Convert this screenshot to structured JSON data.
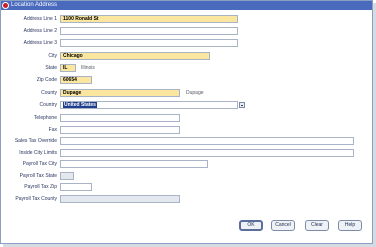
{
  "window": {
    "title": "Location Address"
  },
  "fields": {
    "address1": {
      "label": "Address Line 1",
      "value": "1100 Ronald St"
    },
    "address2": {
      "label": "Address Line 2",
      "value": ""
    },
    "address3": {
      "label": "Address Line 3",
      "value": ""
    },
    "city": {
      "label": "City",
      "value": "Chicago"
    },
    "state": {
      "label": "State",
      "value": "IL",
      "description": "Illinois"
    },
    "zip": {
      "label": "Zip Code",
      "value": "60654"
    },
    "county": {
      "label": "County",
      "value": "Dupage",
      "description": "Dupage"
    },
    "country": {
      "label": "Country",
      "value": "United States"
    },
    "telephone": {
      "label": "Telephone",
      "value": ""
    },
    "fax": {
      "label": "Fax",
      "value": ""
    },
    "sales_tax_override": {
      "label": "Sales Tax Override",
      "value": ""
    },
    "inside_city_limits": {
      "label": "Inside City Limits",
      "value": ""
    },
    "payroll_tax_city": {
      "label": "Payroll Tax City",
      "value": ""
    },
    "payroll_tax_state": {
      "label": "Payroll Tax State",
      "value": ""
    },
    "payroll_tax_zip": {
      "label": "Payroll Tax Zip",
      "value": ""
    },
    "payroll_tax_county": {
      "label": "Payroll Tax County",
      "value": ""
    }
  },
  "buttons": {
    "ok": "OK",
    "cancel": "Cancel",
    "clear": "Clear",
    "help": "Help"
  },
  "colors": {
    "title_bar": "#4a6bbd",
    "required_field": "#fbe6a0",
    "selection": "#1f3f8c"
  }
}
